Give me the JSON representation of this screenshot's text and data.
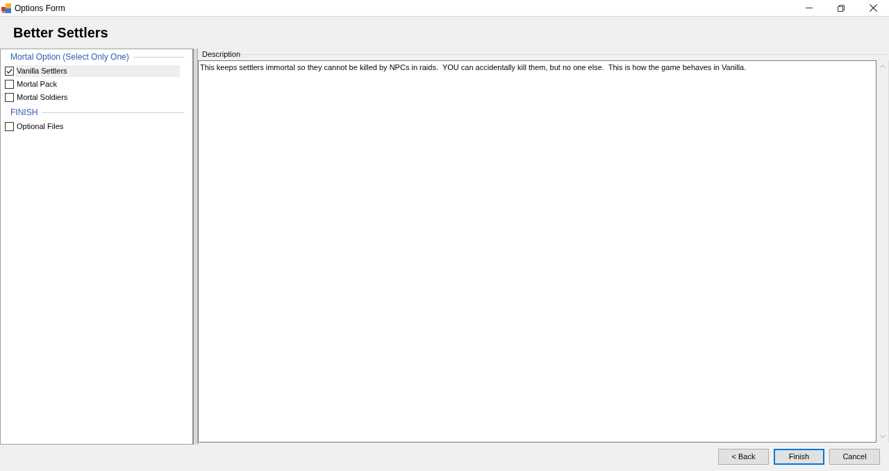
{
  "window": {
    "title": "Options Form"
  },
  "header": {
    "title": "Better Settlers"
  },
  "option_groups": [
    {
      "title": "Mortal Option (Select Only One)",
      "options": [
        {
          "label": "Vanilla Settlers",
          "checked": true,
          "selected": true
        },
        {
          "label": "Mortal Pack",
          "checked": false,
          "selected": false
        },
        {
          "label": "Mortal Soldiers",
          "checked": false,
          "selected": false
        }
      ]
    },
    {
      "title": "FINISH",
      "options": [
        {
          "label": "Optional Files",
          "checked": false,
          "selected": false
        }
      ]
    }
  ],
  "description": {
    "label": "Description",
    "text": "This keeps settlers immortal so they cannot be killed by NPCs in raids.  YOU can accidentally kill them, but no one else.  This is how the game behaves in Vanilla."
  },
  "buttons": [
    {
      "label": "< Back",
      "focused": false
    },
    {
      "label": "Finish",
      "focused": true
    },
    {
      "label": "Cancel",
      "focused": false
    }
  ]
}
